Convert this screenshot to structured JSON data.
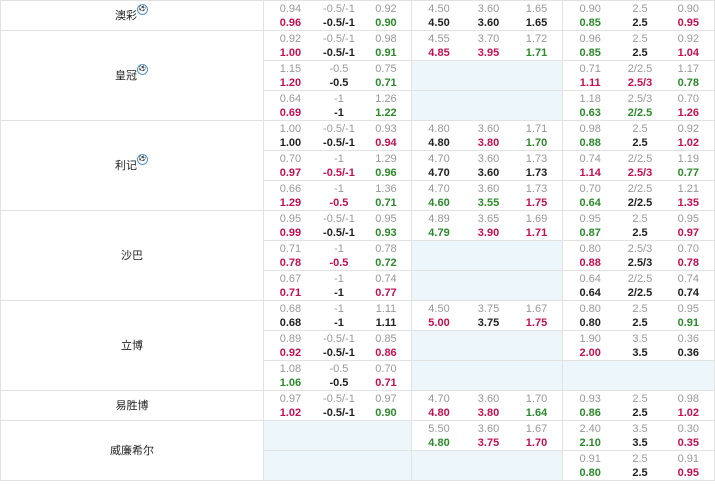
{
  "rows": [
    {
      "company": "澳彩",
      "flag": true,
      "span": 1,
      "asian": {
        "old": [
          "0.94",
          "-0.5/-1",
          "0.92"
        ],
        "new": [
          [
            "0.96",
            "up"
          ],
          [
            "-0.5/-1",
            ""
          ],
          [
            "0.90",
            "down"
          ]
        ]
      },
      "euro": {
        "old": [
          "4.50",
          "3.60",
          "1.65"
        ],
        "new": [
          [
            "4.50",
            ""
          ],
          [
            "3.60",
            ""
          ],
          [
            "1.65",
            ""
          ]
        ]
      },
      "total": {
        "old": [
          "0.90",
          "2.5",
          "0.90"
        ],
        "new": [
          [
            "0.85",
            "down"
          ],
          [
            "2.5",
            ""
          ],
          [
            "0.95",
            "up"
          ]
        ]
      }
    },
    {
      "company": "皇冠",
      "flag": true,
      "span": 3,
      "asian": {
        "old": [
          "0.92",
          "-0.5/-1",
          "0.98"
        ],
        "new": [
          [
            "1.00",
            "up"
          ],
          [
            "-0.5/-1",
            ""
          ],
          [
            "0.91",
            "down"
          ]
        ]
      },
      "euro": {
        "old": [
          "4.55",
          "3.70",
          "1.72"
        ],
        "new": [
          [
            "4.85",
            "up"
          ],
          [
            "3.95",
            "up"
          ],
          [
            "1.71",
            "down"
          ]
        ]
      },
      "total": {
        "old": [
          "0.96",
          "2.5",
          "0.92"
        ],
        "new": [
          [
            "0.85",
            "down"
          ],
          [
            "2.5",
            ""
          ],
          [
            "1.04",
            "up"
          ]
        ]
      }
    },
    {
      "asian": {
        "old": [
          "1.15",
          "-0.5",
          "0.75"
        ],
        "new": [
          [
            "1.20",
            "up"
          ],
          [
            "-0.5",
            ""
          ],
          [
            "0.71",
            "down"
          ]
        ]
      },
      "euro": null,
      "total": {
        "old": [
          "0.71",
          "2/2.5",
          "1.17"
        ],
        "new": [
          [
            "1.11",
            "up"
          ],
          [
            "2.5/3",
            "up"
          ],
          [
            "0.78",
            "down"
          ]
        ]
      }
    },
    {
      "asian": {
        "old": [
          "0.64",
          "-1",
          "1.26"
        ],
        "new": [
          [
            "0.69",
            "up"
          ],
          [
            "-1",
            ""
          ],
          [
            "1.22",
            "down"
          ]
        ]
      },
      "euro": null,
      "total": {
        "old": [
          "1.18",
          "2.5/3",
          "0.70"
        ],
        "new": [
          [
            "0.63",
            "down"
          ],
          [
            "2/2.5",
            "down"
          ],
          [
            "1.26",
            "up"
          ]
        ]
      }
    },
    {
      "company": "利记",
      "flag": true,
      "span": 3,
      "asian": {
        "old": [
          "1.00",
          "-0.5/-1",
          "0.93"
        ],
        "new": [
          [
            "1.00",
            ""
          ],
          [
            "-0.5/-1",
            ""
          ],
          [
            "0.94",
            "up"
          ]
        ]
      },
      "euro": {
        "old": [
          "4.80",
          "3.60",
          "1.71"
        ],
        "new": [
          [
            "4.80",
            ""
          ],
          [
            "3.80",
            "up"
          ],
          [
            "1.70",
            "down"
          ]
        ]
      },
      "total": {
        "old": [
          "0.98",
          "2.5",
          "0.92"
        ],
        "new": [
          [
            "0.88",
            "down"
          ],
          [
            "2.5",
            ""
          ],
          [
            "1.02",
            "up"
          ]
        ]
      }
    },
    {
      "asian": {
        "old": [
          "0.70",
          "-1",
          "1.29"
        ],
        "new": [
          [
            "0.97",
            "up"
          ],
          [
            "-0.5/-1",
            "up"
          ],
          [
            "0.96",
            "down"
          ]
        ]
      },
      "euro": {
        "old": [
          "4.70",
          "3.60",
          "1.73"
        ],
        "new": [
          [
            "4.70",
            ""
          ],
          [
            "3.60",
            ""
          ],
          [
            "1.73",
            ""
          ]
        ]
      },
      "total": {
        "old": [
          "0.74",
          "2/2.5",
          "1.19"
        ],
        "new": [
          [
            "1.14",
            "up"
          ],
          [
            "2.5/3",
            "up"
          ],
          [
            "0.77",
            "down"
          ]
        ]
      }
    },
    {
      "asian": {
        "old": [
          "0.66",
          "-1",
          "1.36"
        ],
        "new": [
          [
            "1.29",
            "up"
          ],
          [
            "-0.5",
            "up"
          ],
          [
            "0.71",
            "down"
          ]
        ]
      },
      "euro": {
        "old": [
          "4.70",
          "3.60",
          "1.73"
        ],
        "new": [
          [
            "4.60",
            "down"
          ],
          [
            "3.55",
            "down"
          ],
          [
            "1.75",
            "up"
          ]
        ]
      },
      "total": {
        "old": [
          "0.70",
          "2/2.5",
          "1.21"
        ],
        "new": [
          [
            "0.64",
            "down"
          ],
          [
            "2/2.5",
            ""
          ],
          [
            "1.35",
            "up"
          ]
        ]
      }
    },
    {
      "company": "沙巴",
      "flag": false,
      "span": 3,
      "asian": {
        "old": [
          "0.95",
          "-0.5/-1",
          "0.95"
        ],
        "new": [
          [
            "0.99",
            "up"
          ],
          [
            "-0.5/-1",
            ""
          ],
          [
            "0.93",
            "down"
          ]
        ]
      },
      "euro": {
        "old": [
          "4.89",
          "3.65",
          "1.69"
        ],
        "new": [
          [
            "4.79",
            "down"
          ],
          [
            "3.90",
            "up"
          ],
          [
            "1.71",
            "up"
          ]
        ]
      },
      "total": {
        "old": [
          "0.95",
          "2.5",
          "0.95"
        ],
        "new": [
          [
            "0.87",
            "down"
          ],
          [
            "2.5",
            ""
          ],
          [
            "0.97",
            "up"
          ]
        ]
      }
    },
    {
      "asian": {
        "old": [
          "0.71",
          "-1",
          "0.78"
        ],
        "new": [
          [
            "0.78",
            "up"
          ],
          [
            "-0.5",
            "up"
          ],
          [
            "0.72",
            "down"
          ]
        ]
      },
      "euro": null,
      "total": {
        "old": [
          "0.80",
          "2.5/3",
          "0.70"
        ],
        "new": [
          [
            "0.88",
            "up"
          ],
          [
            "2.5/3",
            ""
          ],
          [
            "0.78",
            "up"
          ]
        ]
      }
    },
    {
      "asian": {
        "old": [
          "0.67",
          "-1",
          "0.74"
        ],
        "new": [
          [
            "0.71",
            "up"
          ],
          [
            "-1",
            ""
          ],
          [
            "0.77",
            "up"
          ]
        ]
      },
      "euro": null,
      "total": {
        "old": [
          "0.64",
          "2/2.5",
          "0.74"
        ],
        "new": [
          [
            "0.64",
            ""
          ],
          [
            "2/2.5",
            ""
          ],
          [
            "0.74",
            ""
          ]
        ]
      }
    },
    {
      "company": "立博",
      "flag": false,
      "span": 3,
      "asian": {
        "old": [
          "0.68",
          "-1",
          "1.11"
        ],
        "new": [
          [
            "0.68",
            ""
          ],
          [
            "-1",
            ""
          ],
          [
            "1.11",
            ""
          ]
        ]
      },
      "euro": {
        "old": [
          "4.50",
          "3.75",
          "1.67"
        ],
        "new": [
          [
            "5.00",
            "up"
          ],
          [
            "3.75",
            ""
          ],
          [
            "1.75",
            "up"
          ]
        ]
      },
      "total": {
        "old": [
          "0.80",
          "2.5",
          "0.95"
        ],
        "new": [
          [
            "0.80",
            ""
          ],
          [
            "2.5",
            ""
          ],
          [
            "0.91",
            "down"
          ]
        ]
      }
    },
    {
      "asian": {
        "old": [
          "0.89",
          "-0.5/-1",
          "0.85"
        ],
        "new": [
          [
            "0.92",
            "up"
          ],
          [
            "-0.5/-1",
            ""
          ],
          [
            "0.86",
            "up"
          ]
        ]
      },
      "euro": null,
      "total": {
        "old": [
          "1.90",
          "3.5",
          "0.36"
        ],
        "new": [
          [
            "2.00",
            "up"
          ],
          [
            "3.5",
            ""
          ],
          [
            "0.36",
            ""
          ]
        ]
      }
    },
    {
      "asian": {
        "old": [
          "1.08",
          "-0.5",
          "0.70"
        ],
        "new": [
          [
            "1.06",
            "down"
          ],
          [
            "-0.5",
            ""
          ],
          [
            "0.71",
            "up"
          ]
        ]
      },
      "euro": null,
      "total": null
    },
    {
      "company": "易胜博",
      "flag": false,
      "span": 1,
      "asian": {
        "old": [
          "0.97",
          "-0.5/-1",
          "0.97"
        ],
        "new": [
          [
            "1.02",
            "up"
          ],
          [
            "-0.5/-1",
            ""
          ],
          [
            "0.90",
            "down"
          ]
        ]
      },
      "euro": {
        "old": [
          "4.70",
          "3.60",
          "1.70"
        ],
        "new": [
          [
            "4.80",
            "up"
          ],
          [
            "3.80",
            "up"
          ],
          [
            "1.64",
            "down"
          ]
        ]
      },
      "total": {
        "old": [
          "0.93",
          "2.5",
          "0.98"
        ],
        "new": [
          [
            "0.86",
            "down"
          ],
          [
            "2.5",
            ""
          ],
          [
            "1.02",
            "up"
          ]
        ]
      }
    },
    {
      "company": "威廉希尔",
      "flag": false,
      "span": 2,
      "asian": null,
      "euro": {
        "old": [
          "5.50",
          "3.60",
          "1.67"
        ],
        "new": [
          [
            "4.80",
            "down"
          ],
          [
            "3.75",
            "up"
          ],
          [
            "1.70",
            "up"
          ]
        ]
      },
      "total": {
        "old": [
          "2.40",
          "3.5",
          "0.30"
        ],
        "new": [
          [
            "2.10",
            "down"
          ],
          [
            "3.5",
            ""
          ],
          [
            "0.35",
            "up"
          ]
        ]
      }
    },
    {
      "asian": null,
      "euro": null,
      "total": {
        "old": [
          "0.91",
          "2.5",
          "0.91"
        ],
        "new": [
          [
            "0.80",
            "down"
          ],
          [
            "2.5",
            ""
          ],
          [
            "0.95",
            "up"
          ]
        ]
      }
    }
  ]
}
